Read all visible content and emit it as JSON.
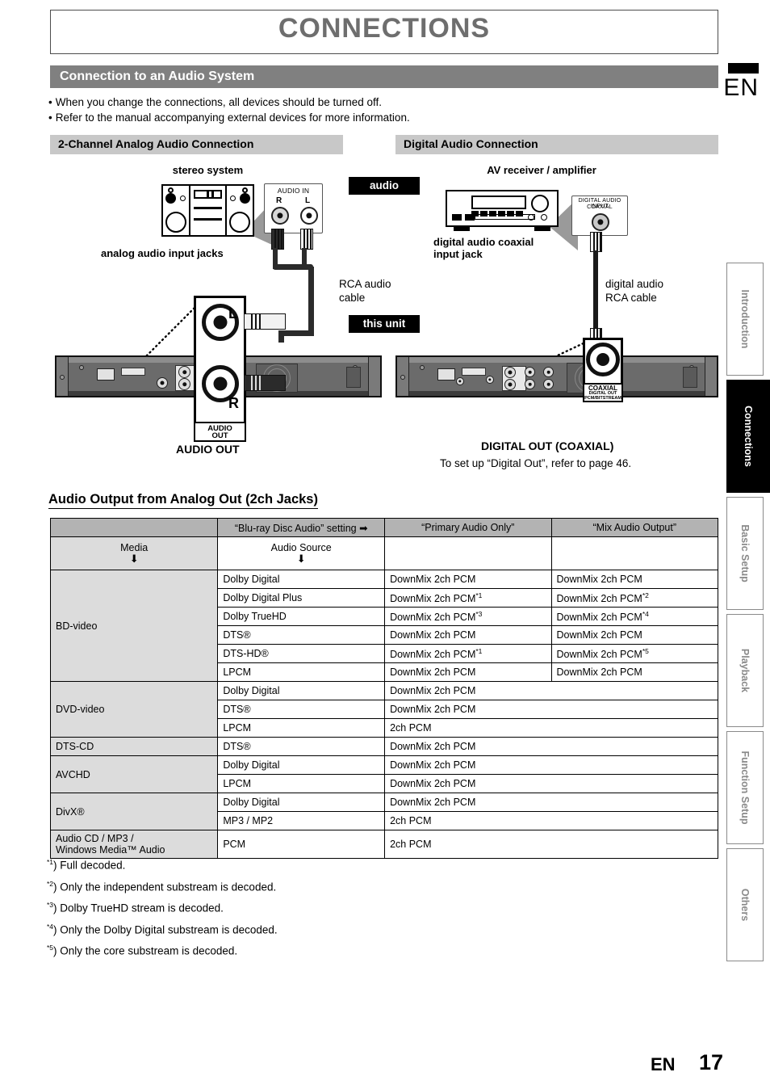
{
  "chapter": {
    "title": "CONNECTIONS"
  },
  "section": {
    "title": "Connection to an Audio System"
  },
  "notes": [
    "When you change the connections, all devices should be turned off.",
    "Refer to the manual accompanying external devices for more information."
  ],
  "subsections": {
    "left": "2-Channel Analog Audio Connection",
    "right": "Digital Audio Connection"
  },
  "diagram_left": {
    "device_label": "stereo system",
    "jacks_label": "analog audio input jacks",
    "callout_title_line1": "AUDIO IN",
    "callout_jack_r": "R",
    "callout_jack_l": "L",
    "cable_label": "RCA audio\ncable",
    "badge_audio": "audio",
    "badge_this_unit": "this unit",
    "unit_jack_l": "L",
    "unit_jack_r": "R",
    "unit_jack_box_line1": "AUDIO",
    "unit_jack_box_line2": "OUT",
    "unit_caption": "AUDIO OUT"
  },
  "diagram_right": {
    "device_label": "AV receiver / amplifier",
    "jack_label": "digital audio coaxial\ninput jack",
    "callout_title_line1": "DIGITAL AUDIO INPUT",
    "callout_title_line2": "COAXIAL",
    "cable_label": "digital audio\nRCA cable",
    "unit_jack_line1": "COAXIAL",
    "unit_jack_line2": "DIGITAL OUT",
    "unit_jack_line3": "PCM/BITSTREAM",
    "caption_title": "DIGITAL OUT (COAXIAL)",
    "caption_sub": "To set up “Digital Out”, refer to page 46."
  },
  "table": {
    "heading": "Audio Output from Analog Out (2ch Jacks)",
    "header_row": {
      "corner": "",
      "setting": "“Blu-ray Disc Audio” setting ➡",
      "primary": "“Primary Audio Only”",
      "mix": "“Mix Audio Output”"
    },
    "subheader_row": {
      "media": "Media",
      "arrow": "⬇",
      "source": "Audio Source"
    },
    "groups": [
      {
        "media": "BD-video",
        "rows": [
          {
            "source": "Dolby Digital",
            "primary": "DownMix 2ch PCM",
            "primary_sup": "",
            "mix": "DownMix 2ch PCM",
            "mix_sup": ""
          },
          {
            "source": "Dolby Digital Plus",
            "primary": "DownMix 2ch PCM",
            "primary_sup": "*1",
            "mix": "DownMix 2ch PCM",
            "mix_sup": "*2"
          },
          {
            "source": "Dolby TrueHD",
            "primary": "DownMix 2ch PCM",
            "primary_sup": "*3",
            "mix": "DownMix 2ch PCM",
            "mix_sup": "*4"
          },
          {
            "source": "DTS®",
            "primary": "DownMix 2ch PCM",
            "primary_sup": "",
            "mix": "DownMix 2ch PCM",
            "mix_sup": ""
          },
          {
            "source": "DTS-HD®",
            "primary": "DownMix 2ch PCM",
            "primary_sup": "*1",
            "mix": "DownMix 2ch PCM",
            "mix_sup": "*5"
          },
          {
            "source": "LPCM",
            "primary": "DownMix 2ch PCM",
            "primary_sup": "",
            "mix": "DownMix 2ch PCM",
            "mix_sup": ""
          }
        ]
      },
      {
        "media": "DVD-video",
        "rows": [
          {
            "source": "Dolby Digital",
            "span": "DownMix 2ch PCM"
          },
          {
            "source": "DTS®",
            "span": "DownMix 2ch PCM"
          },
          {
            "source": "LPCM",
            "span": "2ch PCM"
          }
        ]
      },
      {
        "media": "DTS-CD",
        "rows": [
          {
            "source": "DTS®",
            "span": "DownMix 2ch PCM"
          }
        ]
      },
      {
        "media": "AVCHD",
        "rows": [
          {
            "source": "Dolby Digital",
            "span": "DownMix 2ch PCM"
          },
          {
            "source": "LPCM",
            "span": "DownMix 2ch PCM"
          }
        ]
      },
      {
        "media": "DivX®",
        "rows": [
          {
            "source": "Dolby Digital",
            "span": "DownMix 2ch PCM"
          },
          {
            "source": "MP3 / MP2",
            "span": "2ch PCM"
          }
        ]
      },
      {
        "media": "Audio CD / MP3 /\nWindows Media™ Audio",
        "rows": [
          {
            "source": "PCM",
            "span": "2ch PCM"
          }
        ]
      }
    ]
  },
  "footnotes": [
    {
      "mark": "*1",
      "text": ") Full decoded."
    },
    {
      "mark": "*2",
      "text": ") Only the independent substream is decoded."
    },
    {
      "mark": "*3",
      "text": ") Dolby TrueHD stream is decoded."
    },
    {
      "mark": "*4",
      "text": ") Only the Dolby Digital substream is decoded."
    },
    {
      "mark": "*5",
      "text": ") Only the core substream is decoded."
    }
  ],
  "sidebar": {
    "language_mark": "EN",
    "tabs": [
      {
        "label": "Introduction",
        "active": false
      },
      {
        "label": "Connections",
        "active": true
      },
      {
        "label": "Basic Setup",
        "active": false
      },
      {
        "label": "Playback",
        "active": false
      },
      {
        "label": "Function Setup",
        "active": false
      },
      {
        "label": "Others",
        "active": false
      }
    ]
  },
  "footer": {
    "lang": "EN",
    "page": "17"
  }
}
